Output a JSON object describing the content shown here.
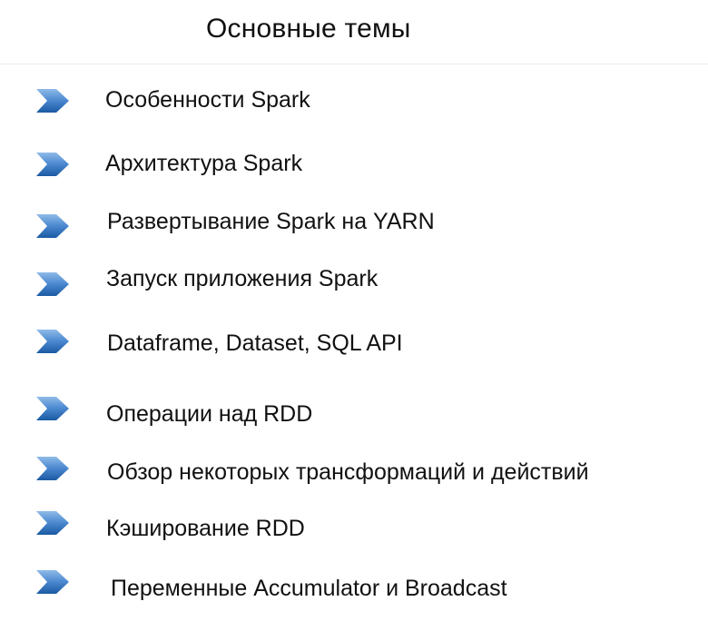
{
  "header": {
    "title": "Основные темы"
  },
  "items": [
    {
      "label": "Особенности Spark",
      "icon": "chevron-right-icon"
    },
    {
      "label": "Архитектура Spark",
      "icon": "chevron-right-icon"
    },
    {
      "label": "Развертывание Spark на YARN",
      "icon": "chevron-right-icon"
    },
    {
      "label": "Запуск приложения Spark",
      "icon": "chevron-right-icon"
    },
    {
      "label": "Dataframe, Dataset, SQL API",
      "icon": "chevron-right-icon"
    },
    {
      "label": "Операции над RDD",
      "icon": "chevron-right-icon"
    },
    {
      "label": "Обзор некоторых трансформаций и действий",
      "icon": "chevron-right-icon"
    },
    {
      "label": "Кэширование RDD",
      "icon": "chevron-right-icon"
    },
    {
      "label": "Переменные Accumulator и Broadcast",
      "icon": "chevron-right-icon"
    }
  ],
  "colors": {
    "bullet_top": "#7fb0e3",
    "bullet_bottom": "#1f5fa8",
    "text": "#111111"
  }
}
